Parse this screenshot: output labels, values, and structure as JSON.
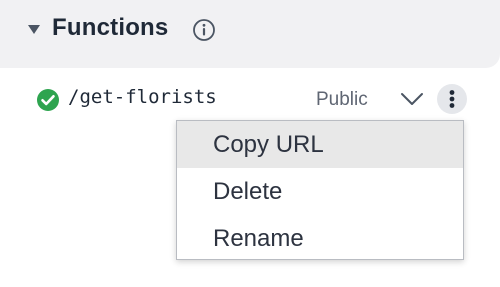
{
  "section": {
    "title": "Functions"
  },
  "function_row": {
    "name": "/get-florists",
    "visibility": "Public",
    "status_icon": "check-circle-icon",
    "status_color": "#2ea44f"
  },
  "menu": {
    "items": [
      {
        "label": "Copy URL",
        "highlighted": true
      },
      {
        "label": "Delete",
        "highlighted": false
      },
      {
        "label": "Rename",
        "highlighted": false
      }
    ]
  },
  "colors": {
    "header_bg": "#f1f1f3",
    "highlight_bg": "#e8e8e8"
  }
}
